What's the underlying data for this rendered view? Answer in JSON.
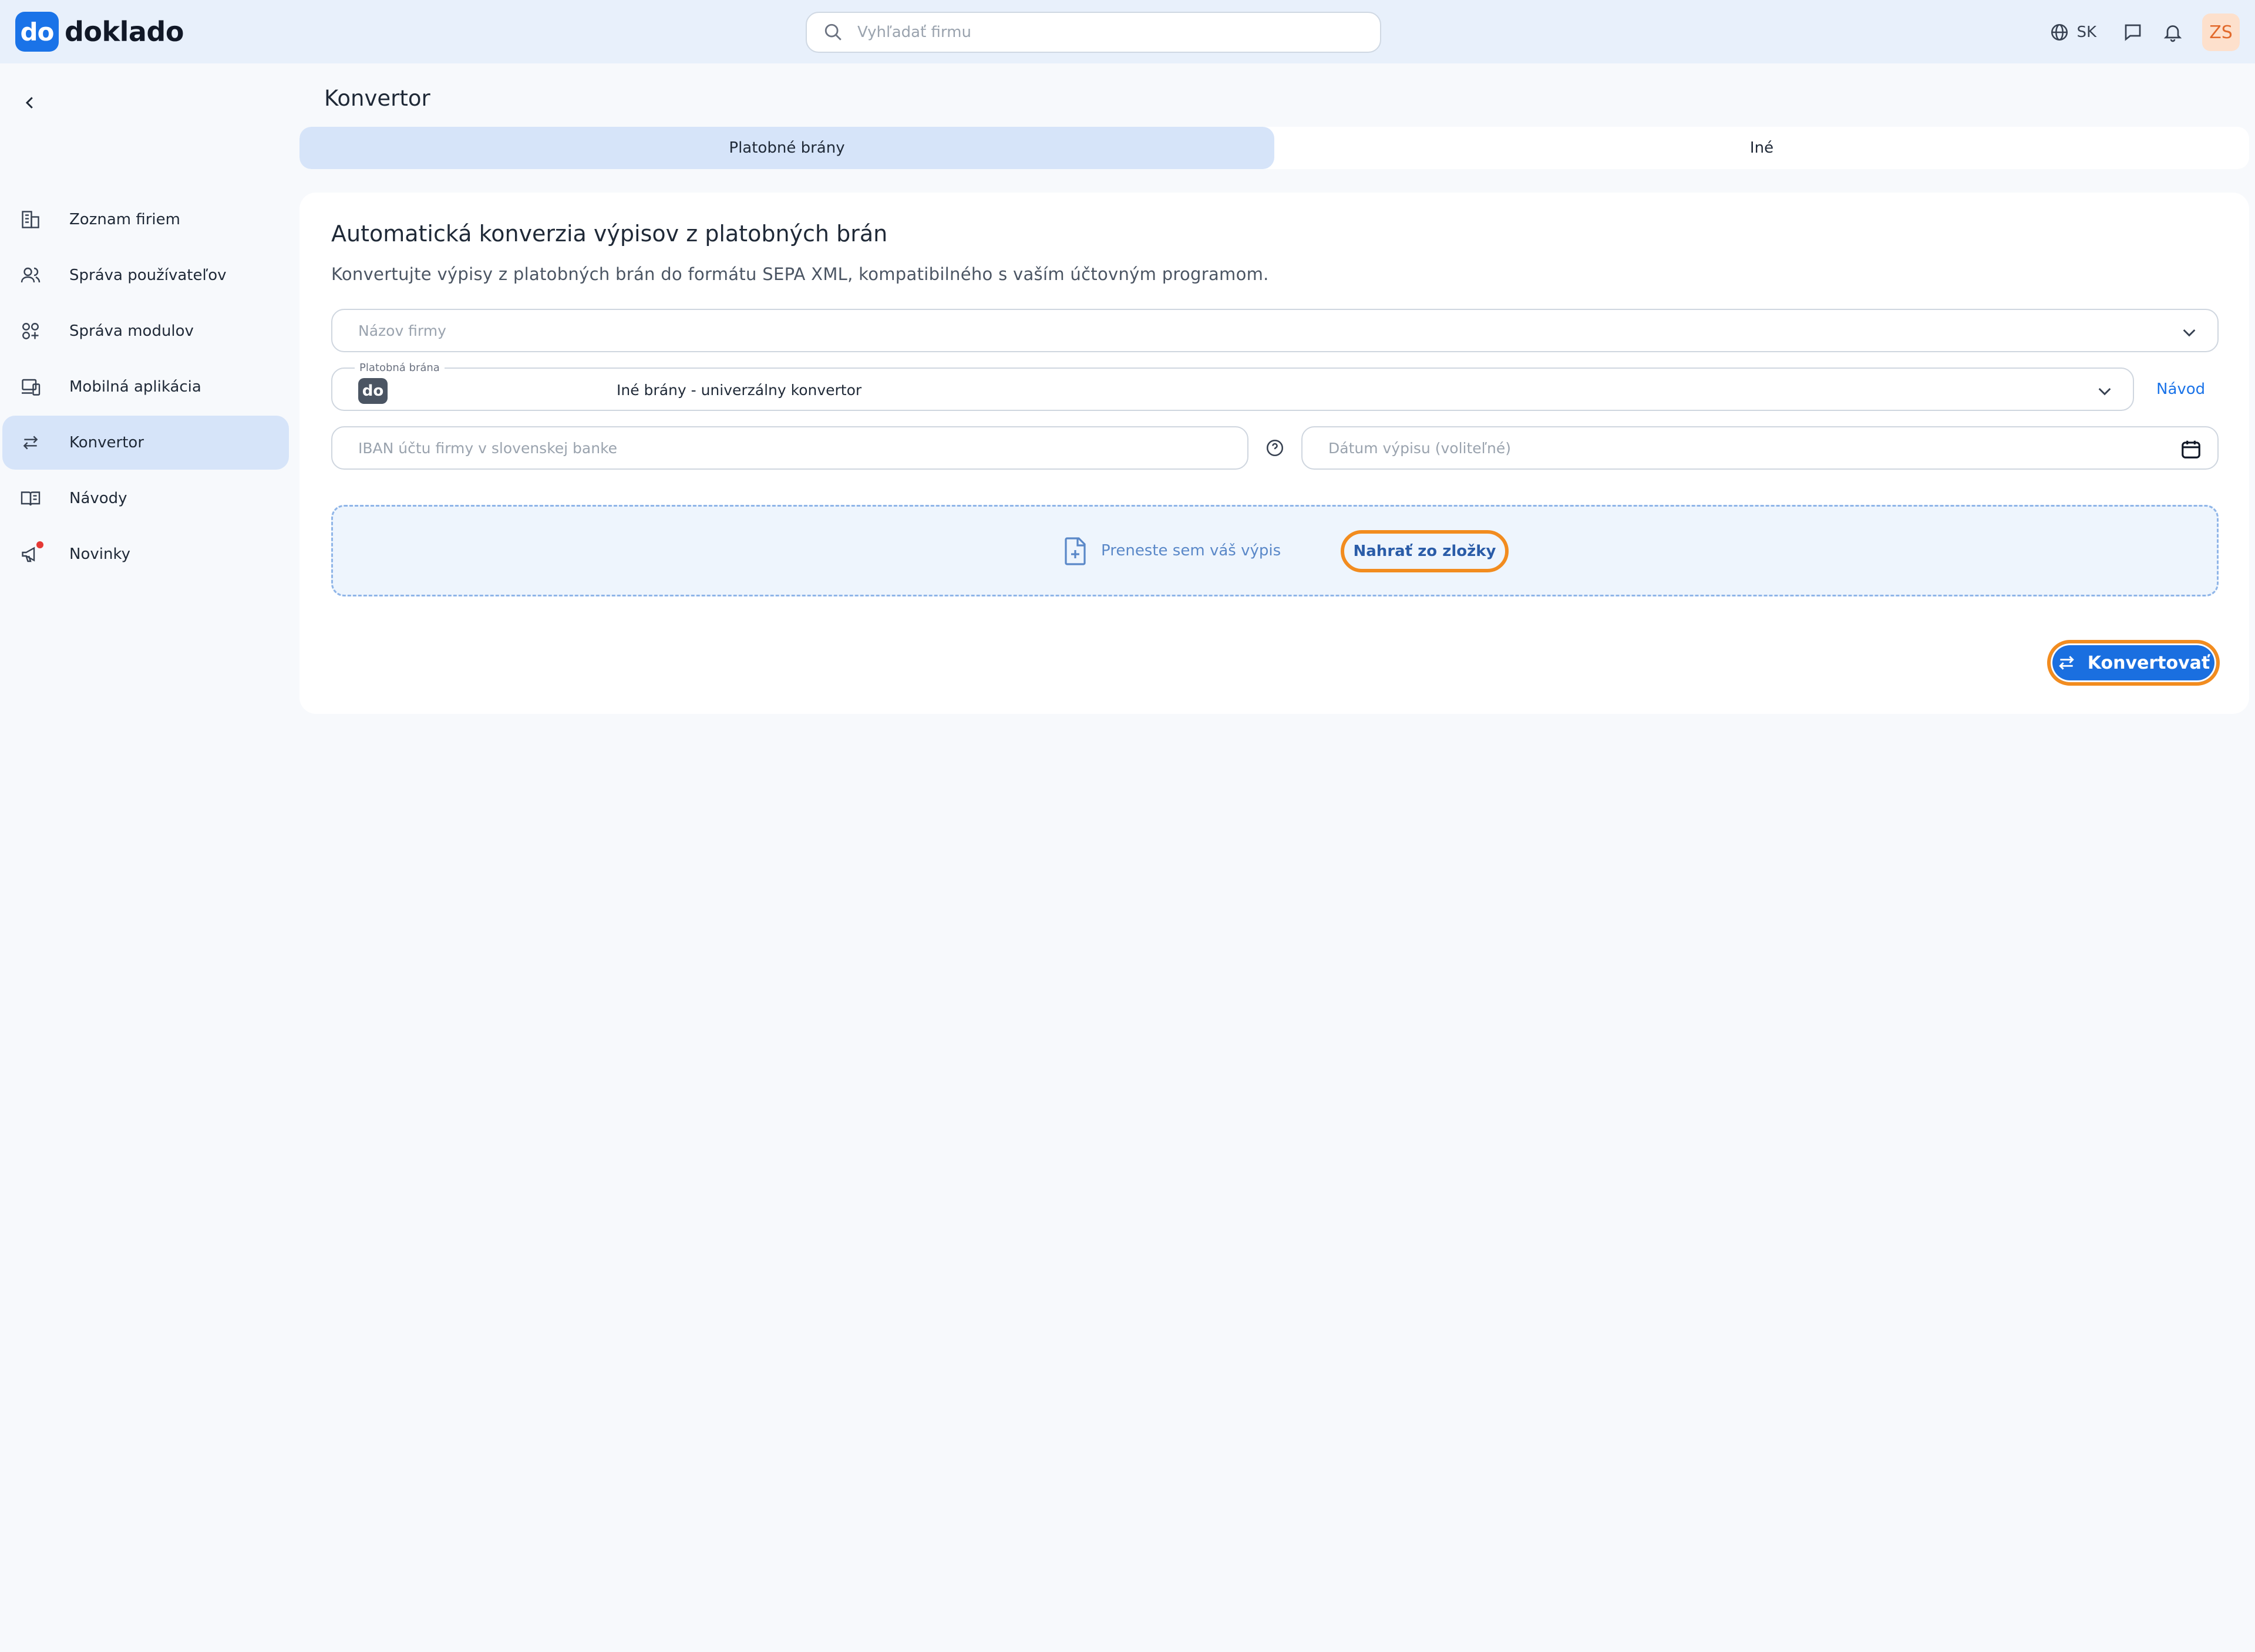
{
  "app": {
    "logo_mark": "do",
    "logo_text": "doklado"
  },
  "search": {
    "placeholder": "Vyhľadať firmu"
  },
  "top_right": {
    "language": "SK",
    "avatar_initials": "ZS"
  },
  "sidebar": {
    "items": [
      {
        "label": "Zoznam firiem",
        "icon": "building-icon"
      },
      {
        "label": "Správa používateľov",
        "icon": "users-icon"
      },
      {
        "label": "Správa modulov",
        "icon": "modules-icon"
      },
      {
        "label": "Mobilná aplikácia",
        "icon": "devices-icon"
      },
      {
        "label": "Konvertor",
        "icon": "arrows-swap-icon",
        "active": true
      },
      {
        "label": "Návody",
        "icon": "book-icon"
      },
      {
        "label": "Novinky",
        "icon": "megaphone-icon"
      }
    ]
  },
  "page": {
    "title": "Konvertor"
  },
  "tabs": [
    {
      "label": "Platobné brány",
      "active": true
    },
    {
      "label": "Iné",
      "active": false
    }
  ],
  "card": {
    "title": "Automatická konverzia výpisov z platobných brán",
    "subtitle": "Konvertujte výpisy z platobných brán do formátu SEPA XML, kompatibilného s vaším účtovným programom.",
    "company_field": {
      "placeholder": "Názov firmy"
    },
    "gateway_field": {
      "legend": "Platobná brána",
      "logo": "do",
      "value": "Iné brány - univerzálny konvertor"
    },
    "guide_link": "Návod",
    "iban_field": {
      "placeholder": "IBAN účtu firmy v slovenskej banke"
    },
    "date_field": {
      "placeholder": "Dátum výpisu (voliteľné)"
    },
    "dropzone": {
      "text": "Preneste sem váš výpis",
      "upload_button": "Nahrať zo zložky"
    },
    "convert_button": "Konvertovať"
  },
  "colors": {
    "accent": "#1a73e8",
    "highlight": "#f28c1f",
    "active_bg": "#d6e4f9"
  }
}
